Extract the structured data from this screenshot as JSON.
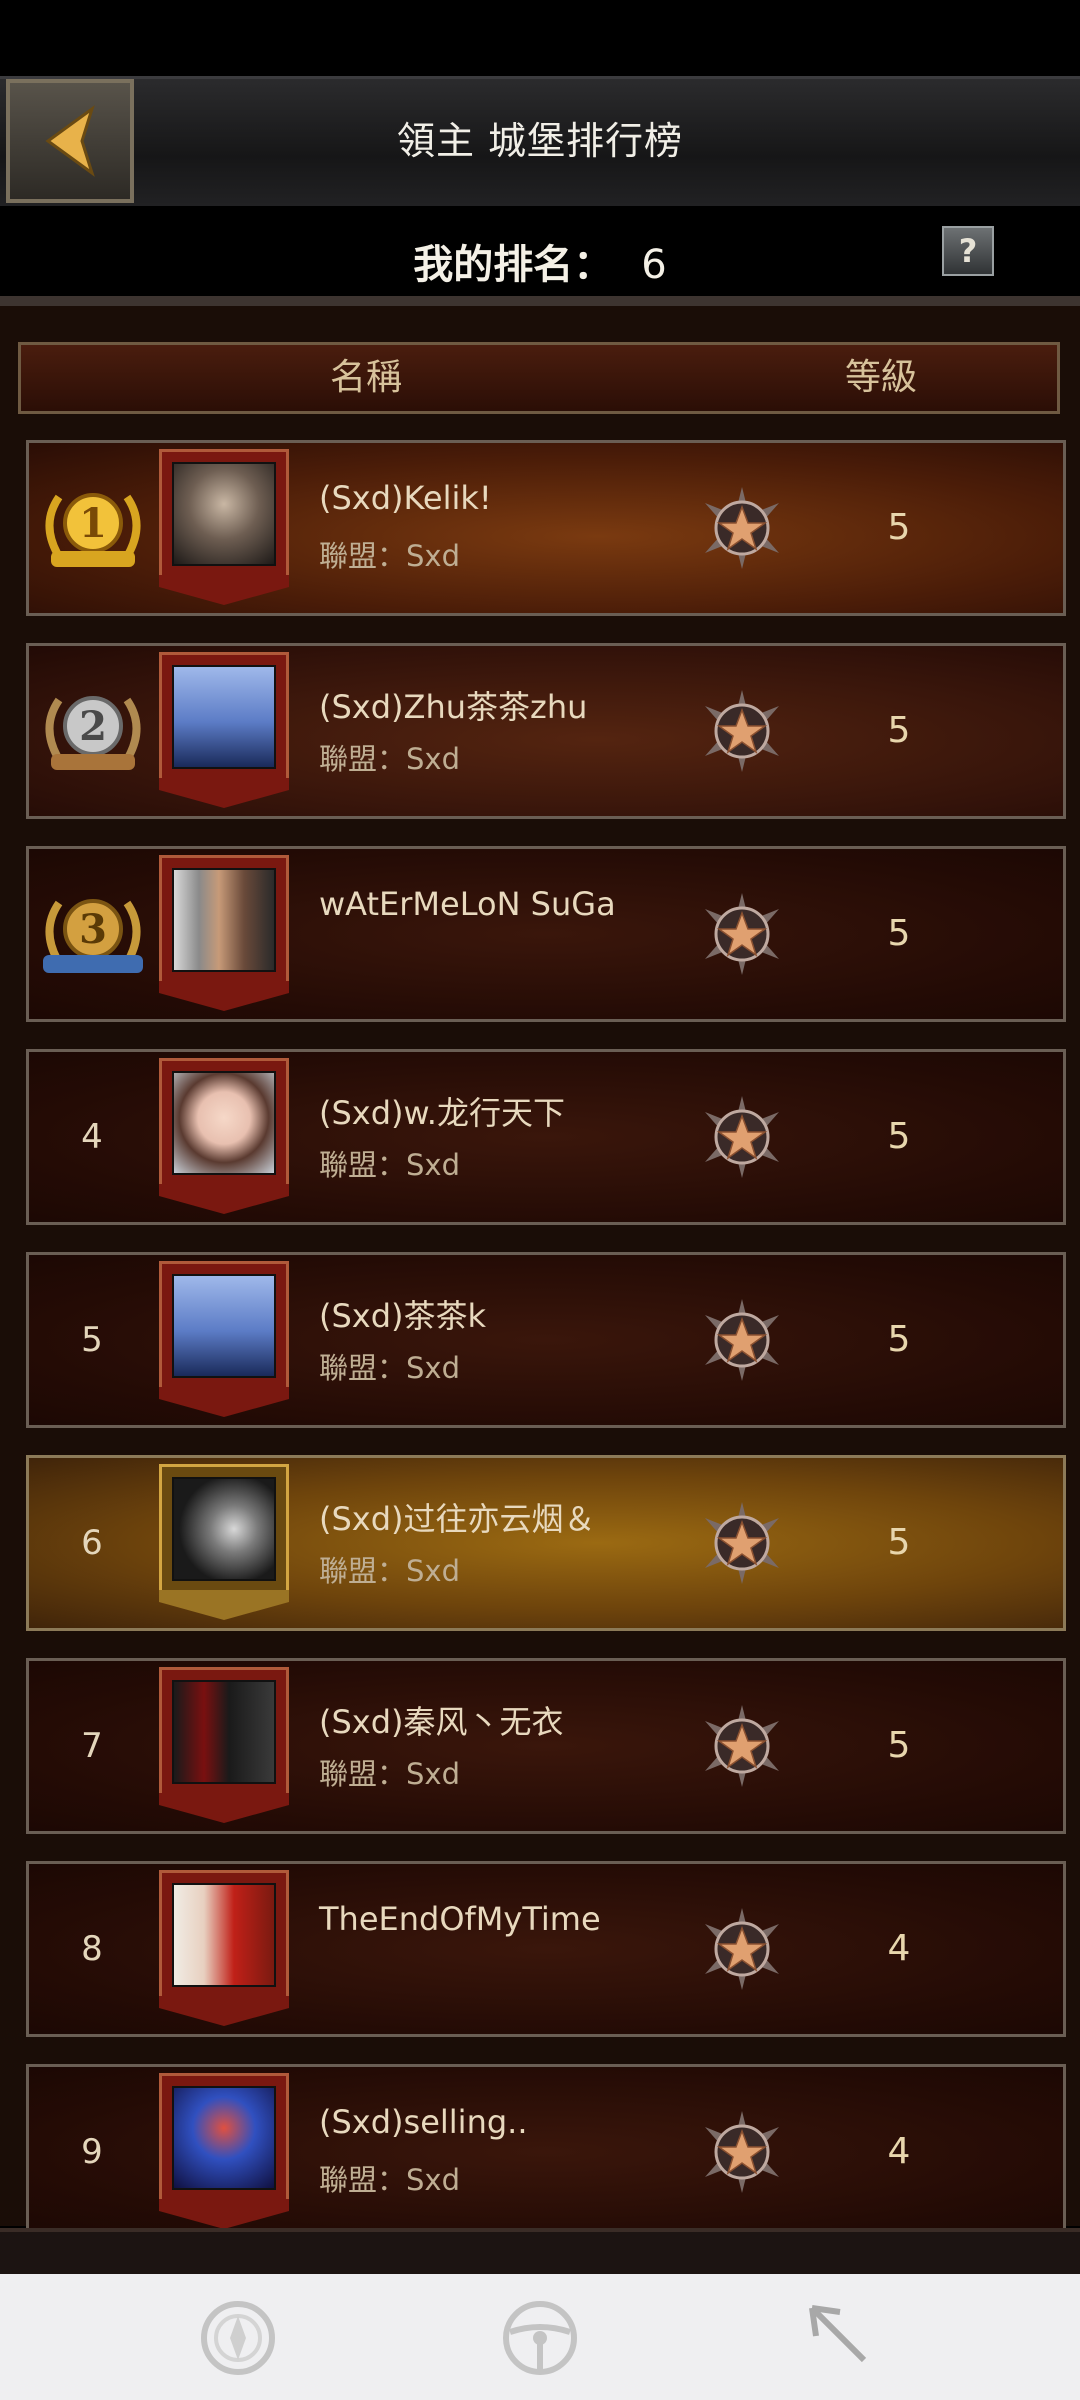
{
  "header": {
    "title": "領主 城堡排行榜"
  },
  "my_rank": {
    "label": "我的排名：",
    "value": "6"
  },
  "help": {
    "label": "?"
  },
  "columns": {
    "name": "名稱",
    "level": "等級"
  },
  "rows": [
    {
      "rank": "1",
      "name": "(Sxd)Kelik!",
      "alliance": "聯盟：Sxd",
      "level": "5"
    },
    {
      "rank": "2",
      "name": "(Sxd)Zhu茶茶zhu",
      "alliance": "聯盟：Sxd",
      "level": "5"
    },
    {
      "rank": "3",
      "name": "wAtErMeLoN SuGa",
      "alliance": "",
      "level": "5"
    },
    {
      "rank": "4",
      "name": "(Sxd)w.龙行天下",
      "alliance": "聯盟：Sxd",
      "level": "5"
    },
    {
      "rank": "5",
      "name": "(Sxd)茶茶k",
      "alliance": "聯盟：Sxd",
      "level": "5"
    },
    {
      "rank": "6",
      "name": "(Sxd)过往亦云烟＆",
      "alliance": "聯盟：Sxd",
      "level": "5"
    },
    {
      "rank": "7",
      "name": "(Sxd)秦风丶无衣",
      "alliance": "聯盟：Sxd",
      "level": "5"
    },
    {
      "rank": "8",
      "name": "TheEndOfMyTime",
      "alliance": "",
      "level": "4"
    },
    {
      "rank": "9",
      "name": "(Sxd)selling..",
      "alliance": "聯盟：Sxd",
      "level": "4"
    }
  ],
  "icons": {
    "back": "back-arrow-icon",
    "medals": [
      "gold-medal-icon",
      "silver-medal-icon",
      "bronze-medal-icon"
    ],
    "level_badge": "star-badge-icon",
    "nav": [
      "aperture-icon",
      "steering-wheel-icon",
      "cursor-arrow-icon"
    ]
  },
  "colors": {
    "highlight_row": "#9b6a12",
    "medal_gold": "#d8a520",
    "medal_silver": "#a9a9a9",
    "medal_bronze": "#3f6cb0"
  }
}
